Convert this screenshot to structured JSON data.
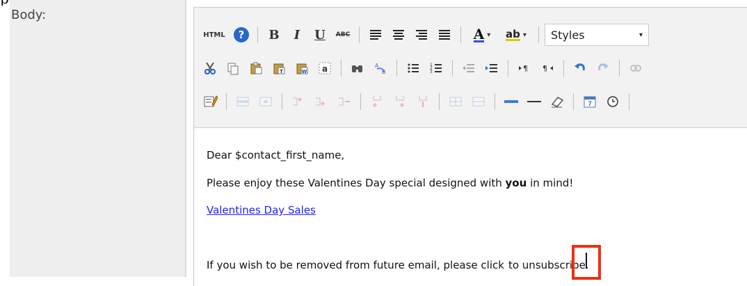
{
  "field": {
    "label": "Body:"
  },
  "toolbar": {
    "html": "HTML",
    "bold": "B",
    "italic": "I",
    "underline": "U",
    "strikethrough": "ABC",
    "font_color_letter": "A",
    "highlight_letters": "ab",
    "styles_label": "Styles"
  },
  "content": {
    "line1": "Dear $contact_first_name,",
    "line2_prefix": "Please enjoy these Valentines Day special designed with ",
    "line2_bold": "you",
    "line2_suffix": " in mind!",
    "link": "Valentines Day Sales",
    "line5_before": "If you wish to be removed from future email, please clic",
    "line5_k": "k",
    "line5_to": "t",
    "line5_o": "o",
    "line5_after": " unsubscribe."
  },
  "colors": {
    "highlight_box": "#ef2f10",
    "link": "#2020ff"
  }
}
